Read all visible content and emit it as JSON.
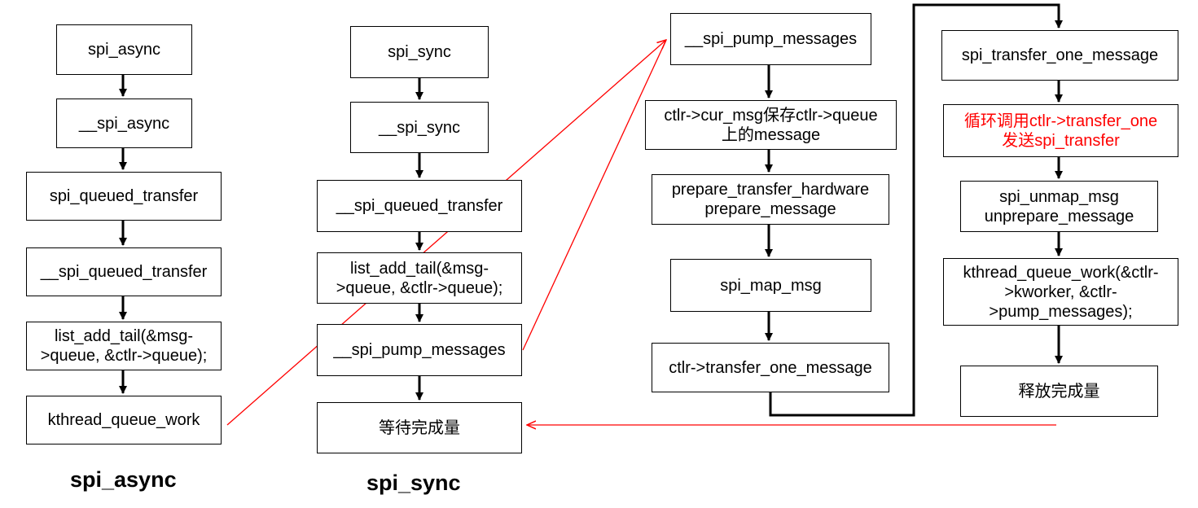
{
  "colors": {
    "line": "#000000",
    "highlight": "#ff0000"
  },
  "async_flow": {
    "caption": "spi_async",
    "steps": [
      {
        "lines": [
          "spi_async"
        ]
      },
      {
        "lines": [
          "__spi_async"
        ]
      },
      {
        "lines": [
          "spi_queued_transfer"
        ]
      },
      {
        "lines": [
          "__spi_queued_transfer"
        ]
      },
      {
        "lines": [
          "list_add_tail(&msg-",
          ">queue, &ctlr->queue);"
        ]
      },
      {
        "lines": [
          "kthread_queue_work"
        ]
      }
    ]
  },
  "sync_flow": {
    "caption": "spi_sync",
    "steps": [
      {
        "lines": [
          "spi_sync"
        ]
      },
      {
        "lines": [
          "__spi_sync"
        ]
      },
      {
        "lines": [
          "__spi_queued_transfer"
        ]
      },
      {
        "lines": [
          "list_add_tail(&msg-",
          ">queue, &ctlr->queue);"
        ]
      },
      {
        "lines": [
          "__spi_pump_messages"
        ]
      },
      {
        "lines": [
          "等待完成量"
        ]
      }
    ]
  },
  "pump_flow": {
    "steps": [
      {
        "lines": [
          "__spi_pump_messages"
        ]
      },
      {
        "lines": [
          "ctlr->cur_msg保存ctlr->queue",
          "上的message"
        ]
      },
      {
        "lines": [
          "prepare_transfer_hardware",
          "prepare_message"
        ]
      },
      {
        "lines": [
          "spi_map_msg"
        ]
      },
      {
        "lines": [
          "ctlr->transfer_one_message"
        ]
      }
    ]
  },
  "transfer_flow": {
    "steps": [
      {
        "lines": [
          "spi_transfer_one_message"
        ]
      },
      {
        "lines": [
          "循环调用ctlr->transfer_one",
          "发送spi_transfer"
        ],
        "highlight": true
      },
      {
        "lines": [
          "spi_unmap_msg",
          "unprepare_message"
        ]
      },
      {
        "lines": [
          "kthread_queue_work(&ctlr-",
          ">kworker, &ctlr-",
          ">pump_messages);"
        ]
      },
      {
        "lines": [
          "释放完成量"
        ]
      }
    ]
  }
}
